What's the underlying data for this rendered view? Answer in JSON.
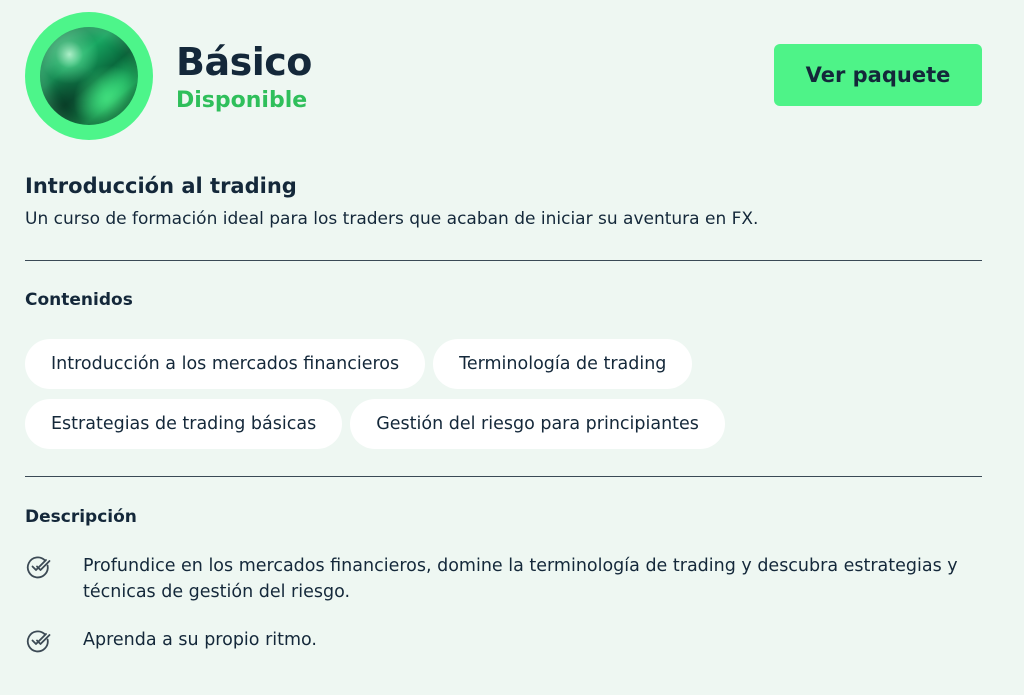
{
  "package": {
    "title": "Básico",
    "status": "Disponible",
    "cta_label": "Ver paquete"
  },
  "course": {
    "title": "Introducción al trading",
    "subtitle": "Un curso de formación ideal para los traders que acaban de iniciar su aventura en FX."
  },
  "contents": {
    "label": "Contenidos",
    "chips": [
      "Introducción a los mercados financieros",
      "Terminología de trading",
      "Estrategias de trading básicas",
      "Gestión del riesgo para principiantes"
    ]
  },
  "description": {
    "label": "Descripción",
    "items": [
      "Profundice en los mercados financieros, domine la terminología de trading y descubra estrategias y técnicas de gestión del riesgo.",
      "Aprenda a su propio ritmo."
    ],
    "icon": "double-check-icon"
  },
  "colors": {
    "accent": "#4ef388",
    "status": "#2fbf5b",
    "text": "#14283a",
    "background": "#eef7f2"
  }
}
